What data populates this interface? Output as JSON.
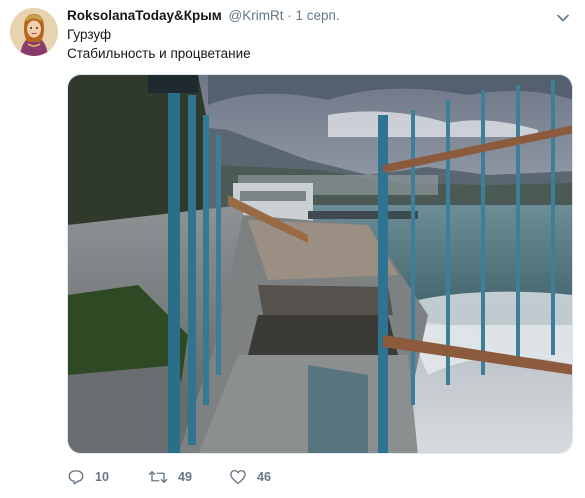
{
  "tweet": {
    "display_name": "RoksolanaToday&Крым",
    "handle": "@KrimRt",
    "separator": "·",
    "time": "1 серп.",
    "lines": [
      "Гурзуф",
      "Стабильность и процветание"
    ]
  },
  "actions": {
    "replies": "10",
    "retweets": "49",
    "likes": "46"
  },
  "icons": {
    "menu": "chevron-down-icon",
    "reply": "reply-icon",
    "retweet": "retweet-icon",
    "like": "heart-icon"
  },
  "colors": {
    "text": "#14171a",
    "secondary": "#657786",
    "border": "#e1e8ed"
  }
}
